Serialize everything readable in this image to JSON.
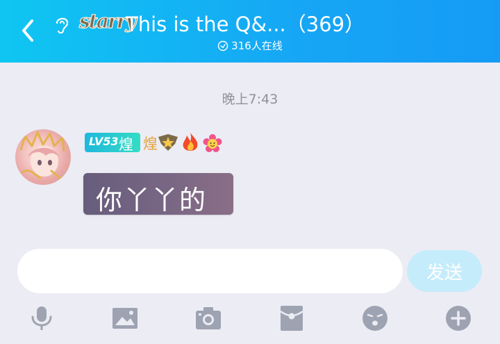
{
  "header": {
    "logo_text": "starry",
    "title": "This is the Q&...（369）",
    "online": "316人在线"
  },
  "chat": {
    "timestamp": "晚上7:43",
    "message": {
      "level": "LV53",
      "level_title": "煌",
      "title_badge": "煌",
      "text": "你丫丫的"
    }
  },
  "composer": {
    "input_value": "",
    "send_label": "发送"
  },
  "toolbar": {
    "icons": [
      "microphone-icon",
      "image-icon",
      "camera-icon",
      "red-packet-icon",
      "emoji-icon",
      "plus-icon"
    ]
  },
  "colors": {
    "header_start": "#0fc6f2",
    "header_end": "#159bf5",
    "background": "#ececf4",
    "icon": "#9ea3b2",
    "send_disabled": "#c5ecfb"
  }
}
